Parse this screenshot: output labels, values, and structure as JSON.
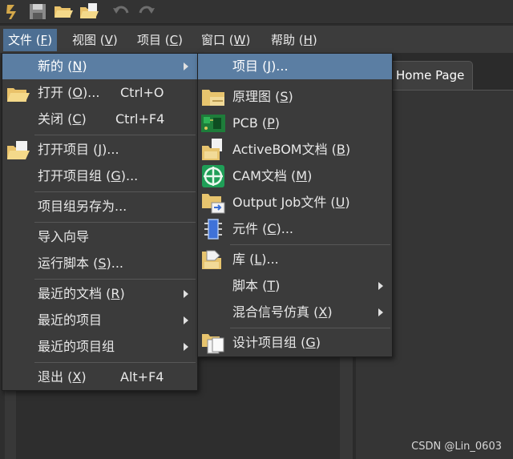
{
  "menubar": {
    "file": "文件 (",
    "file_key": "F",
    "file_end": ")",
    "view": "视图 (",
    "view_key": "V",
    "view_end": ")",
    "project": "项目 (",
    "project_key": "C",
    "project_end": ")",
    "window": "窗口 (",
    "window_key": "W",
    "window_end": ")",
    "help": "帮助 (",
    "help_key": "H",
    "help_end": ")"
  },
  "file_menu": {
    "new": "新的 (",
    "new_key": "N",
    "new_end": ")",
    "open": "打开 (",
    "open_key": "O",
    "open_end": ")...",
    "open_shortcut": "Ctrl+O",
    "close": "关闭 (",
    "close_key": "C",
    "close_end": ")",
    "close_shortcut": "Ctrl+F4",
    "open_project": "打开项目 (",
    "open_project_key": "J",
    "open_project_end": ")...",
    "open_project_group": "打开项目组 (",
    "open_project_group_key": "G",
    "open_project_group_end": ")...",
    "save_project_group_as": "项目组另存为...",
    "import_wizard": "导入向导",
    "run_script": "运行脚本 (",
    "run_script_key": "S",
    "run_script_end": ")...",
    "recent_docs": "最近的文档 (",
    "recent_docs_key": "R",
    "recent_docs_end": ")",
    "recent_projects": "最近的项目",
    "recent_project_groups": "最近的项目组",
    "exit": "退出 (",
    "exit_key": "X",
    "exit_end": ")",
    "exit_shortcut": "Alt+F4"
  },
  "new_menu": {
    "project": "项目 (",
    "project_key": "J",
    "project_end": ")...",
    "schematic": "原理图 (",
    "schematic_key": "S",
    "schematic_end": ")",
    "pcb": "PCB (",
    "pcb_key": "P",
    "pcb_end": ")",
    "activebom": "ActiveBOM文档 (",
    "activebom_key": "B",
    "activebom_end": ")",
    "cam": "CAM文档 (",
    "cam_key": "M",
    "cam_end": ")",
    "output_job": "Output Job文件 (",
    "output_job_key": "U",
    "output_job_end": ")",
    "component": "元件 (",
    "component_key": "C",
    "component_end": ")...",
    "library": "库 (",
    "library_key": "L",
    "library_end": ")...",
    "script": "脚本 (",
    "script_key": "T",
    "script_end": ")",
    "mixed_sim": "混合信号仿真 (",
    "mixed_sim_key": "X",
    "mixed_sim_end": ")",
    "design_project_group": "设计项目组 (",
    "design_project_group_key": "G",
    "design_project_group_end": ")"
  },
  "tabs": {
    "home_page": "Home Page"
  },
  "watermark": "CSDN @Lin_0603",
  "icons": [
    "app-logo-icon",
    "save-icon",
    "open-folder-icon",
    "open-project-icon",
    "undo-icon",
    "redo-icon",
    "schematic-icon",
    "pcb-icon",
    "activebom-icon",
    "cam-icon",
    "output-job-icon",
    "component-icon",
    "library-icon",
    "project-group-icon",
    "chevron-right-icon"
  ],
  "colors": {
    "menu_highlight": "#5b7ea3",
    "menubar_active": "#4d6f93",
    "menu_bg": "#3b3b3b"
  }
}
